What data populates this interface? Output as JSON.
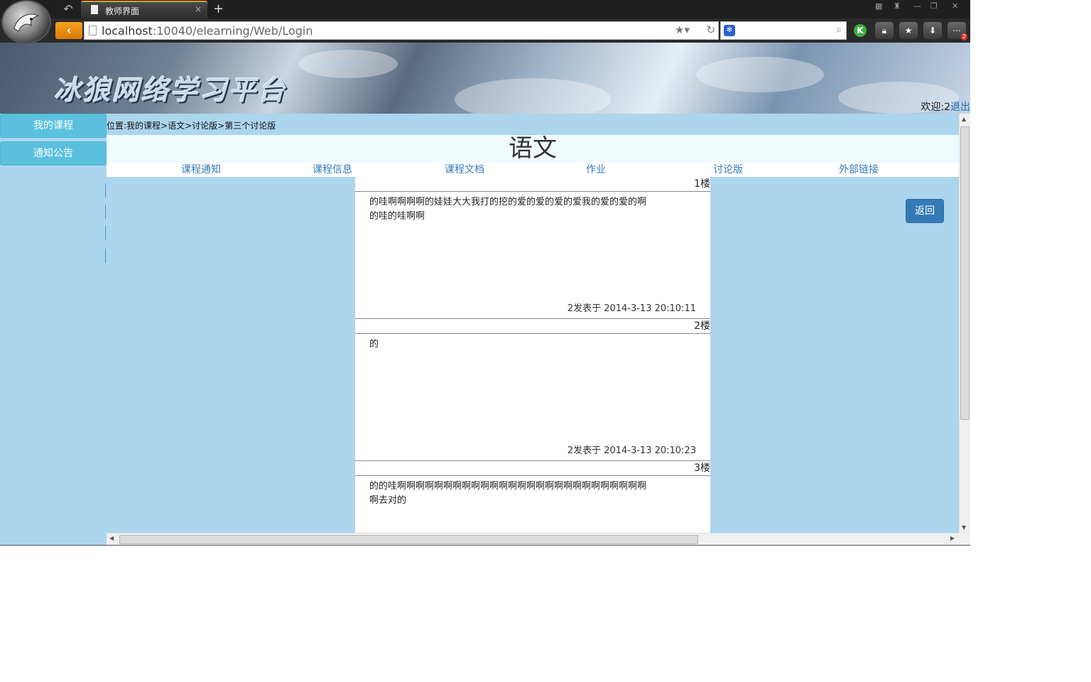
{
  "browser": {
    "tab_title": "教师界面",
    "url_host": "localhost",
    "url_rest": ":10040/elearning/Web/Login",
    "new_tab": "+",
    "tab_close": "×",
    "back_arrow": "‹",
    "engine_icon": "paw-icon",
    "toolbar_k": "K",
    "badge_count": "2"
  },
  "banner": {
    "site_title": "冰狼网络学习平台",
    "welcome_text": "欢迎:2",
    "logout_text": "退出"
  },
  "sidebar": {
    "items": [
      {
        "label": "我的课程"
      },
      {
        "label": "通知公告"
      }
    ]
  },
  "breadcrumb": "位置:我的课程>语文>讨论版>第三个讨论版",
  "course": {
    "title": "语文"
  },
  "nav": {
    "items": [
      {
        "label": "课程通知"
      },
      {
        "label": "课程信息"
      },
      {
        "label": "课程文档"
      },
      {
        "label": "作业"
      },
      {
        "label": "讨论版"
      },
      {
        "label": "外部链接"
      }
    ]
  },
  "posts": [
    {
      "floor": "1楼",
      "body": "的哇啊啊啊啊的娃娃大大我打的挖的爱的爱的爱的爱我的爱的爱的啊的哇的哇啊啊",
      "meta": "2发表于 2014-3-13 20:10:11"
    },
    {
      "floor": "2楼",
      "body": "的",
      "meta": "2发表于 2014-3-13 20:10:23"
    },
    {
      "floor": "3楼",
      "body": "的的哇啊啊啊啊啊啊啊啊啊啊啊啊啊啊啊啊啊啊啊啊啊啊啊啊啊啊啊啊去对的",
      "meta": ""
    }
  ],
  "actions": {
    "return_label": "返回"
  },
  "colors": {
    "page_bg": "#acd5ee",
    "side_button": "#5bc0de",
    "primary_button": "#337ab7",
    "link": "#337ab7",
    "accent_tab": "#e8a11a"
  }
}
